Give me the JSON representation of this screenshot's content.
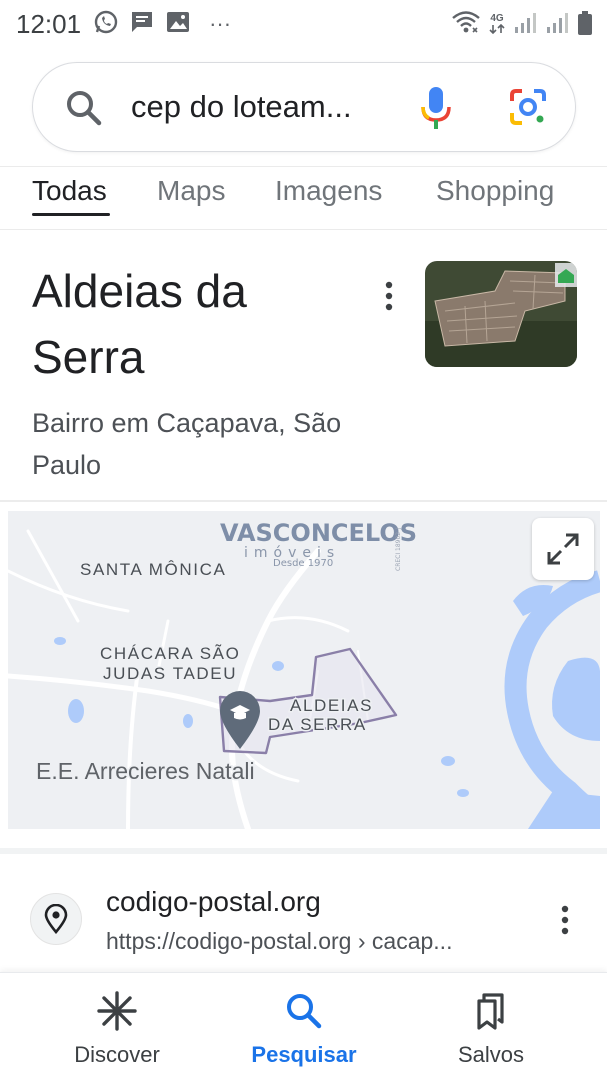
{
  "status_bar": {
    "time": "12:01",
    "left_icons": [
      "whatsapp-icon",
      "message-icon",
      "gallery-icon",
      "more-dots-icon"
    ],
    "dots": "···",
    "network": "4G",
    "right_icons": [
      "wifi-icon",
      "network-4g-icon",
      "signal-icon",
      "signal-icon",
      "battery-icon"
    ]
  },
  "search": {
    "query": "cep do loteam...",
    "icons": [
      "search-icon",
      "mic-icon",
      "google-lens-icon"
    ]
  },
  "tabs": [
    {
      "label": "Todas",
      "active": true
    },
    {
      "label": "Maps",
      "active": false
    },
    {
      "label": "Imagens",
      "active": false
    },
    {
      "label": "Shopping",
      "active": false
    }
  ],
  "knowledge_panel": {
    "title": "Aldeias da Serra",
    "subtitle": "Bairro em Caçapava, São Paulo",
    "more_icon": "more-vertical-icon"
  },
  "map": {
    "labels": {
      "santa_monica": "SANTA MÔNICA",
      "chacara_line1": "CHÁCARA SÃO",
      "chacara_line2": "JUDAS TADEU",
      "aldeias_line1": "ALDEIAS",
      "aldeias_line2": "DA SERRA",
      "school": "E.E. Arrecieres Natali"
    },
    "watermark": {
      "brand": "VASCONCELOS",
      "tagline": "imóveis",
      "since": "Desde 1970",
      "creci": "CRECI 18902-J"
    },
    "expand_icon": "fullscreen-icon",
    "colors": {
      "water": "#aecbfa",
      "land": "#eef0f3",
      "road": "#ffffff",
      "boundary": "#8a7fa8",
      "pin": "#5f6b7a"
    }
  },
  "result": {
    "site": "codigo-postal.org",
    "url": "https://codigo-postal.org › cacap...",
    "favicon": "location-pin-icon"
  },
  "bottom_nav": [
    {
      "label": "Discover",
      "icon": "asterisk-icon",
      "active": false
    },
    {
      "label": "Pesquisar",
      "icon": "search-icon",
      "active": true
    },
    {
      "label": "Salvos",
      "icon": "bookmarks-icon",
      "active": false
    }
  ],
  "colors": {
    "accent": "#1a73e8",
    "text": "#202124",
    "secondary_text": "#4d5156",
    "tab_inactive": "#70757a"
  }
}
